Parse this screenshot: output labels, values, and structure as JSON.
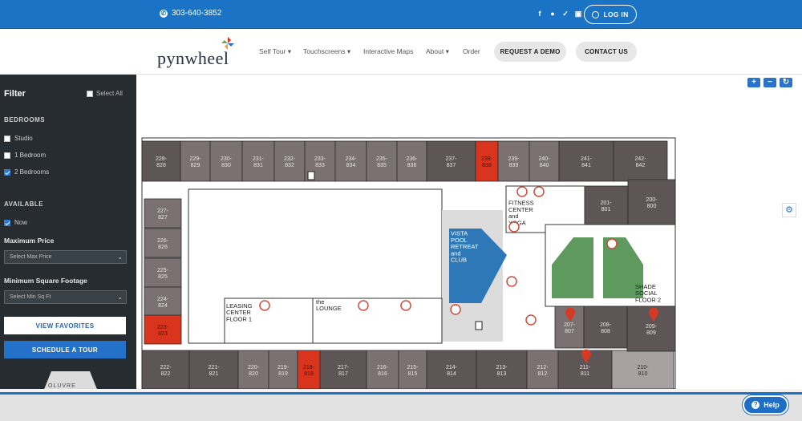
{
  "topbar": {
    "phone": "303-640-3852",
    "login_label": "LOG IN"
  },
  "header": {
    "logo_text": "pynwheel",
    "nav": [
      {
        "label": "Self Tour",
        "caret": "▾"
      },
      {
        "label": "Touchscreens",
        "caret": "▾"
      },
      {
        "label": "Interactive Maps",
        "caret": ""
      },
      {
        "label": "About",
        "caret": "▾"
      },
      {
        "label": "Order",
        "caret": ""
      }
    ],
    "request_demo": "REQUEST A DEMO",
    "contact_us": "CONTACT US"
  },
  "sidebar": {
    "title": "Filter",
    "select_all": "Select All",
    "bedrooms_heading": "BEDROOMS",
    "bedrooms": [
      {
        "label": "Studio",
        "checked": false
      },
      {
        "label": "1 Bedroom",
        "checked": false
      },
      {
        "label": "2 Bedrooms",
        "checked": true
      }
    ],
    "available_heading": "AVAILABLE",
    "available": [
      {
        "label": "Now",
        "checked": true
      }
    ],
    "max_price_label": "Maximum Price",
    "max_price_placeholder": "Select Max Price",
    "min_sqft_label": "Minimum Square Footage",
    "min_sqft_placeholder": "Select Min Sq Ft",
    "view_favorites": "VIEW FAVORITES",
    "schedule_tour": "SCHEDULE A TOUR",
    "brand_badge": "OLUVRE"
  },
  "map": {
    "controls": [
      "+",
      "−",
      "↻"
    ],
    "colors": {
      "unit_dark": "#5e5557",
      "unit_mid": "#7b7173",
      "unit_light": "#a7a1a1",
      "unit_available": "#d9341d",
      "pool": "#2f78b8",
      "green": "#5e9a5e",
      "pin": "#d43a24"
    },
    "units_top": [
      "228-\n828",
      "229-\n829",
      "230-\n830",
      "231-\n831",
      "232-\n832",
      "233-\n833",
      "234-\n834",
      "235-\n835",
      "236-\n836",
      "237-\n837",
      "238-\n838",
      "239-\n839",
      "240-\n840",
      "241-\n841",
      "242-\n842"
    ],
    "units_left": [
      "227-\n827",
      "226-\n826",
      "225-\n825",
      "224-\n824",
      "223-\n823"
    ],
    "units_bottom": [
      "222-\n822",
      "221-\n821",
      "220-\n820",
      "219-\n819",
      "218-\n818",
      "217-\n817",
      "216-\n816",
      "215-\n815",
      "214-\n814",
      "213-\n813",
      "212-\n812",
      "211-\n811",
      "210-\n810"
    ],
    "units_right": [
      "201-\n801",
      "200-\n800",
      "207-\n807",
      "208-\n808",
      "209-\n809"
    ],
    "amenities": {
      "leasing": "LEASING\nCENTER\nFLOOR 1",
      "lounge": "the\nLOUNGE",
      "fitness": "FITNESS\nCENTER\nand\nYOGA",
      "pool": "VISTA\nPOOL\nRETREAT\nand\nCLUB",
      "shade": "SHADE\nSOCIAL\nFLOOR 2"
    }
  },
  "help_label": "Help"
}
